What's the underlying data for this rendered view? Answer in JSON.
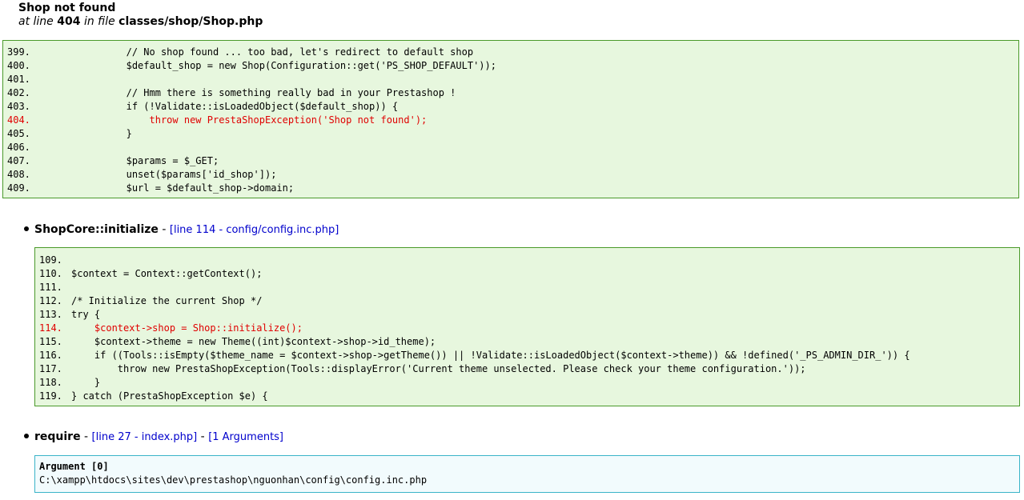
{
  "error": {
    "title": "Shop not found",
    "at_line_prefix": "at line",
    "line": "404",
    "in_file_prefix": "in file",
    "file": "classes/shop/Shop.php"
  },
  "main_code": {
    "lines": [
      {
        "no": "399.",
        "code": "                // No shop found ... too bad, let's redirect to default shop",
        "highlight": false
      },
      {
        "no": "400.",
        "code": "                $default_shop = new Shop(Configuration::get('PS_SHOP_DEFAULT'));",
        "highlight": false
      },
      {
        "no": "401.",
        "code": "",
        "highlight": false
      },
      {
        "no": "402.",
        "code": "                // Hmm there is something really bad in your Prestashop !",
        "highlight": false
      },
      {
        "no": "403.",
        "code": "                if (!Validate::isLoadedObject($default_shop)) {",
        "highlight": false
      },
      {
        "no": "404.",
        "code": "                    throw new PrestaShopException('Shop not found');",
        "highlight": true
      },
      {
        "no": "405.",
        "code": "                }",
        "highlight": false
      },
      {
        "no": "406.",
        "code": "",
        "highlight": false
      },
      {
        "no": "407.",
        "code": "                $params = $_GET;",
        "highlight": false
      },
      {
        "no": "408.",
        "code": "                unset($params['id_shop']);",
        "highlight": false
      },
      {
        "no": "409.",
        "code": "                $url = $default_shop->domain;",
        "highlight": false
      }
    ]
  },
  "frames": [
    {
      "function": "ShopCore::initialize",
      "separator": " - ",
      "link": "[line 114 - config/config.inc.php]",
      "lines": [
        {
          "no": "109.",
          "code": "",
          "highlight": false
        },
        {
          "no": "110.",
          "code": "$context = Context::getContext();",
          "highlight": false
        },
        {
          "no": "111.",
          "code": "",
          "highlight": false
        },
        {
          "no": "112.",
          "code": "/* Initialize the current Shop */",
          "highlight": false
        },
        {
          "no": "113.",
          "code": "try {",
          "highlight": false
        },
        {
          "no": "114.",
          "code": "    $context->shop = Shop::initialize();",
          "highlight": true
        },
        {
          "no": "115.",
          "code": "    $context->theme = new Theme((int)$context->shop->id_theme);",
          "highlight": false
        },
        {
          "no": "116.",
          "code": "    if ((Tools::isEmpty($theme_name = $context->shop->getTheme()) || !Validate::isLoadedObject($context->theme)) && !defined('_PS_ADMIN_DIR_')) {",
          "highlight": false
        },
        {
          "no": "117.",
          "code": "        throw new PrestaShopException(Tools::displayError('Current theme unselected. Please check your theme configuration.'));",
          "highlight": false
        },
        {
          "no": "118.",
          "code": "    }",
          "highlight": false
        },
        {
          "no": "119.",
          "code": "} catch (PrestaShopException $e) {",
          "highlight": false
        }
      ]
    },
    {
      "function": "require",
      "separator": " - ",
      "link": "[line 27 - index.php]",
      "separator2": " - ",
      "args_link": "[1 Arguments]",
      "argument": {
        "title": "Argument [0]",
        "value": "C:\\xampp\\htdocs\\sites\\dev\\prestashop\\nguonhan\\config\\config.inc.php"
      }
    }
  ]
}
